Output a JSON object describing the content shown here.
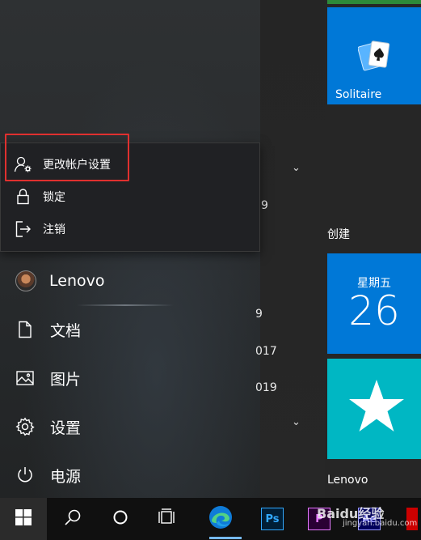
{
  "context_menu": {
    "items": [
      {
        "label": "更改帐户设置",
        "icon": "account-settings-icon"
      },
      {
        "label": "锁定",
        "icon": "lock-icon"
      },
      {
        "label": "注销",
        "icon": "sign-out-icon"
      }
    ]
  },
  "nav": {
    "user": "Lenovo",
    "documents": "文档",
    "pictures": "图片",
    "settings": "设置",
    "power": "电源"
  },
  "app_list_fragments": [
    "9",
    "9",
    "017",
    "019"
  ],
  "tiles": {
    "solitaire": "Solitaire",
    "section_create": "创建",
    "calendar_day": "星期五",
    "calendar_date": "26",
    "section_lenovo": "Lenovo"
  },
  "taskbar": {
    "ps_label": "Ps",
    "pr_label": "P",
    "ae_label": "Ae",
    "watermark": "Baidu经验",
    "watermark_sub": "jingyan.baidu.com"
  },
  "colors": {
    "tile_blue": "#0078d7",
    "tile_teal": "#00b7c3",
    "highlight_red": "#e0302f"
  }
}
